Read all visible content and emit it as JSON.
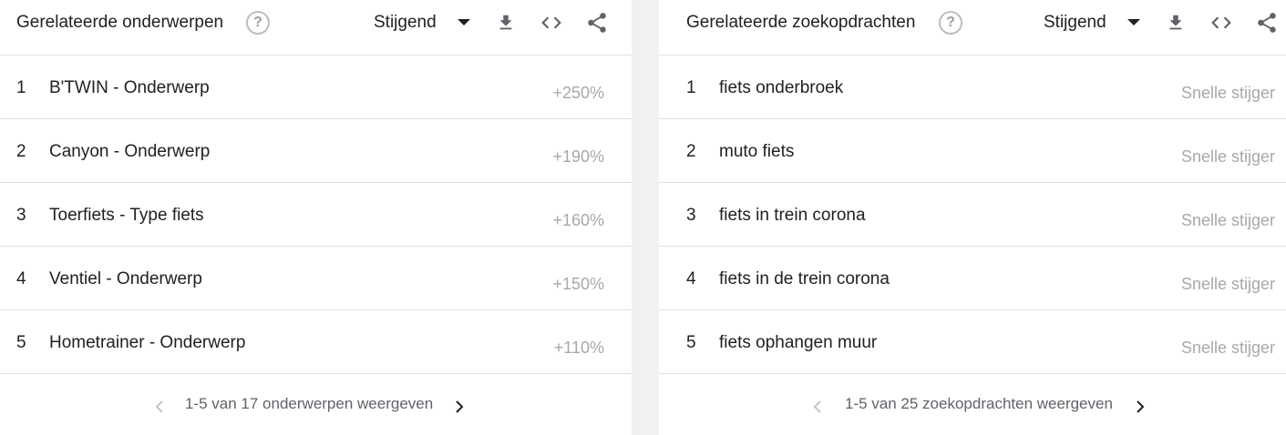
{
  "left_panel": {
    "title": "Gerelateerde onderwerpen",
    "help_glyph": "?",
    "sort_label": "Stijgend",
    "icons": [
      "help-icon",
      "dropdown-caret-icon",
      "download-icon",
      "embed-code-icon",
      "share-icon"
    ],
    "rows": [
      {
        "rank": "1",
        "label": "B'TWIN - Onderwerp",
        "value": "+250%"
      },
      {
        "rank": "2",
        "label": "Canyon - Onderwerp",
        "value": "+190%"
      },
      {
        "rank": "3",
        "label": "Toerfiets - Type fiets",
        "value": "+160%"
      },
      {
        "rank": "4",
        "label": "Ventiel - Onderwerp",
        "value": "+150%"
      },
      {
        "rank": "5",
        "label": "Hometrainer - Onderwerp",
        "value": "+110%"
      }
    ],
    "pagination": "1-5 van 17 onderwerpen weergeven"
  },
  "right_panel": {
    "title": "Gerelateerde zoekopdrachten",
    "help_glyph": "?",
    "sort_label": "Stijgend",
    "icons": [
      "help-icon",
      "dropdown-caret-icon",
      "download-icon",
      "embed-code-icon",
      "share-icon"
    ],
    "rows": [
      {
        "rank": "1",
        "label": "fiets onderbroek",
        "value": "Snelle stijger"
      },
      {
        "rank": "2",
        "label": "muto fiets",
        "value": "Snelle stijger"
      },
      {
        "rank": "3",
        "label": "fiets in trein corona",
        "value": "Snelle stijger"
      },
      {
        "rank": "4",
        "label": "fiets in de trein corona",
        "value": "Snelle stijger"
      },
      {
        "rank": "5",
        "label": "fiets ophangen muur",
        "value": "Snelle stijger"
      }
    ],
    "pagination": "1-5 van 25 zoekopdrachten weergeven"
  },
  "colors": {
    "text": "#202124",
    "muted": "#a8a8a8",
    "icon": "#5f6368",
    "disabled": "#c4c4c4",
    "divider": "#e0e0e0",
    "gutter": "#f1f1f1"
  }
}
